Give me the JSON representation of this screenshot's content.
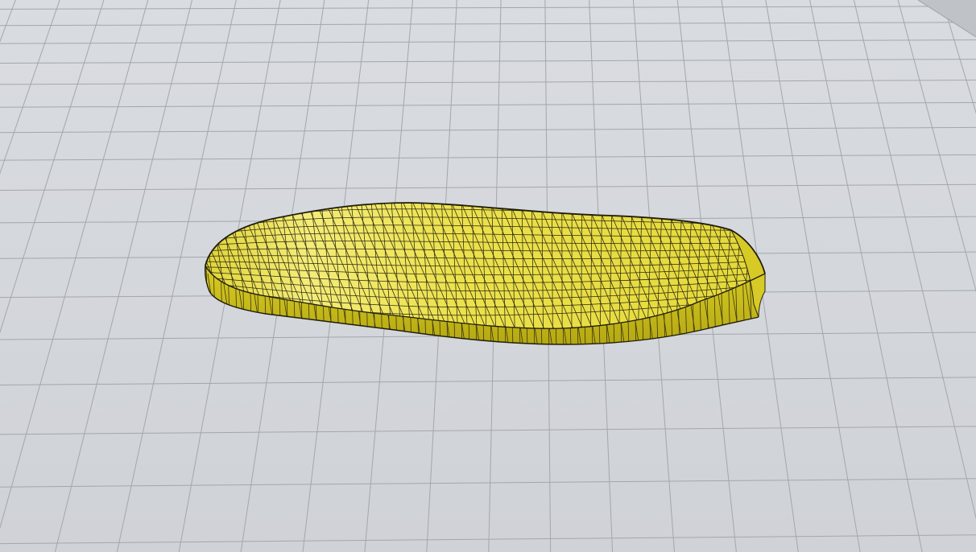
{
  "viewport": {
    "view": "perspective",
    "grid_visible": true,
    "object": {
      "type": "insole-mesh",
      "display_mode": "shaded-wireframe"
    }
  },
  "colors": {
    "background": "#d4d7dc",
    "grid_line": "#a3a7ad",
    "mesh_fill": "#e8dc40",
    "mesh_side": "#c9bc1a",
    "mesh_edge": "#262410"
  }
}
